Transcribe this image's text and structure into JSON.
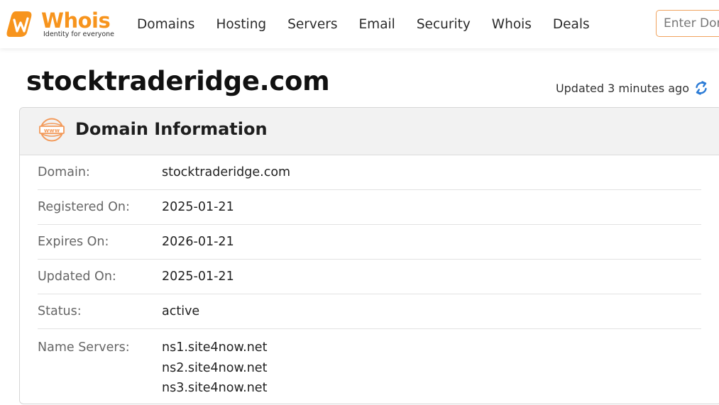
{
  "header": {
    "logo": {
      "wordmark": "Whois",
      "tagline": "Identity for everyone",
      "brand_color": "#f7941d"
    },
    "nav": [
      {
        "label": "Domains"
      },
      {
        "label": "Hosting"
      },
      {
        "label": "Servers"
      },
      {
        "label": "Email"
      },
      {
        "label": "Security"
      },
      {
        "label": "Whois"
      },
      {
        "label": "Deals"
      }
    ],
    "search": {
      "placeholder": "Enter Domain"
    }
  },
  "page": {
    "title": "stocktraderidge.com",
    "updated_text": "Updated 3 minutes ago",
    "refresh_icon": "refresh-icon"
  },
  "card": {
    "icon": "www-icon",
    "title": "Domain Information",
    "rows": [
      {
        "label": "Domain:",
        "value": "stocktraderidge.com"
      },
      {
        "label": "Registered On:",
        "value": "2025-01-21"
      },
      {
        "label": "Expires On:",
        "value": "2026-01-21"
      },
      {
        "label": "Updated On:",
        "value": "2025-01-21"
      },
      {
        "label": "Status:",
        "value": "active"
      }
    ],
    "name_servers": {
      "label": "Name Servers:",
      "values": [
        "ns1.site4now.net",
        "ns2.site4now.net",
        "ns3.site4now.net"
      ]
    }
  },
  "colors": {
    "accent": "#f7941d",
    "search_border": "#f0a35e",
    "refresh": "#2b7bd6",
    "card_header_bg": "#f2f2f2"
  }
}
